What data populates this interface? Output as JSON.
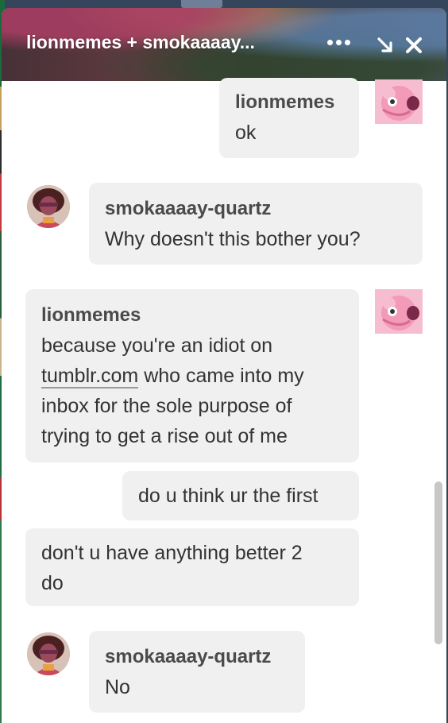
{
  "chat": {
    "title": "lionmemes + smokaaaay...",
    "more_icon": "ellipsis-icon",
    "minimize_icon": "arrow-down-right-icon",
    "close_icon": "close-icon"
  },
  "messages": [
    {
      "sender": "lionmemes",
      "lines": [
        "ok"
      ],
      "avatar": "lion-avatar"
    },
    {
      "sender": "smokaaaay-quartz",
      "lines": [
        "Why doesn't this bother you?"
      ],
      "avatar": "garnet-avatar"
    },
    {
      "sender": "lionmemes",
      "lines": [
        "because you're an idiot on",
        "tumblr.com",
        "who came into my",
        "inbox for the sole purpose of",
        "trying to get a rise out of me"
      ],
      "avatar": "lion-avatar"
    },
    {
      "sender": "",
      "lines": [
        "do u think ur the first"
      ]
    },
    {
      "sender": "",
      "lines": [
        "don't u have anything better 2",
        "do"
      ]
    },
    {
      "sender": "smokaaaay-quartz",
      "lines": [
        "No"
      ],
      "avatar": "garnet-avatar"
    }
  ]
}
